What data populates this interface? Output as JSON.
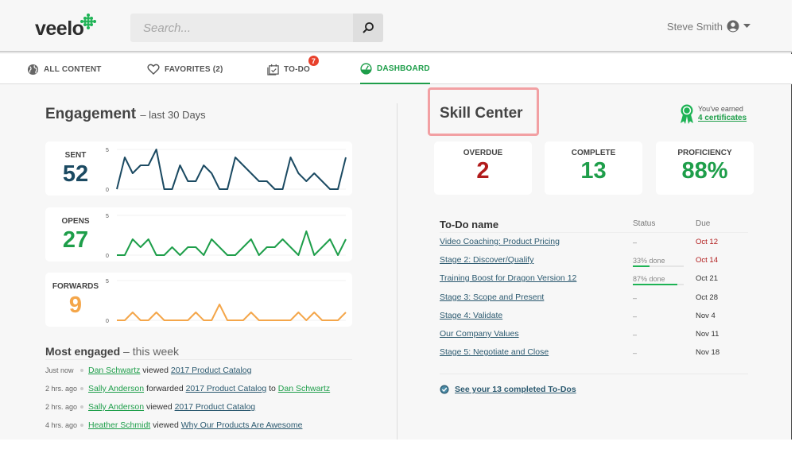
{
  "header": {
    "logo": "veelo",
    "search_placeholder": "Search...",
    "user_name": "Steve Smith"
  },
  "nav": {
    "tabs": [
      {
        "label": "ALL CONTENT",
        "icon": "globe-icon"
      },
      {
        "label": "FAVORITES (2)",
        "icon": "heart-icon"
      },
      {
        "label": "TO-DO",
        "icon": "calendar-check-icon",
        "badge": "7"
      },
      {
        "label": "DASHBOARD",
        "icon": "gauge-icon",
        "active": true
      }
    ]
  },
  "engagement": {
    "title": "Engagement",
    "subtitle": "– last 30 Days",
    "y_max_label": "5",
    "y_min_label": "0",
    "metrics": [
      {
        "label": "SENT",
        "value": "52",
        "color": "#1b4a62",
        "series": [
          0,
          4,
          2,
          3,
          3,
          5,
          0,
          0,
          3,
          1,
          1,
          3,
          2,
          0,
          0,
          4,
          3,
          2,
          1,
          1,
          0,
          0,
          4,
          2,
          1,
          2,
          1,
          0,
          0,
          4
        ]
      },
      {
        "label": "OPENS",
        "value": "27",
        "color": "#1e9e4a",
        "series": [
          0,
          0,
          2,
          1,
          2,
          0,
          0,
          1,
          0,
          1,
          1,
          0,
          2,
          1,
          0,
          0,
          1,
          2,
          0,
          1,
          1,
          2,
          1,
          0,
          3,
          0,
          1,
          2,
          0,
          2
        ]
      },
      {
        "label": "FORWARDS",
        "value": "9",
        "color": "#f4a64a",
        "series": [
          0,
          0,
          1,
          0,
          0,
          1,
          0,
          0,
          0,
          0,
          1,
          0,
          0,
          2,
          0,
          0,
          0,
          1,
          0,
          0,
          0,
          0,
          0,
          1,
          0,
          1,
          0,
          0,
          0,
          1
        ]
      }
    ]
  },
  "most_engaged": {
    "title": "Most engaged",
    "subtitle": "– this week",
    "activities": [
      {
        "time": "Just now",
        "person": "Dan Schwartz",
        "action": "viewed",
        "item": "2017 Product Catalog"
      },
      {
        "time": "2 hrs. ago",
        "person": "Sally Anderson",
        "action": "forwarded",
        "item": "2017 Product Catalog",
        "to_word": "to",
        "target": "Dan Schwartz"
      },
      {
        "time": "2 hrs. ago",
        "person": "Sally Anderson",
        "action": "viewed",
        "item": "2017 Product Catalog"
      },
      {
        "time": "4 hrs. ago",
        "person": "Heather Schmidt",
        "action": "viewed",
        "item": "Why Our Products Are Awesome"
      }
    ]
  },
  "skill_center": {
    "title": "Skill Center",
    "cert_prefix": "You've earned",
    "cert_link": "4 certificates",
    "stats": [
      {
        "label": "OVERDUE",
        "value": "2",
        "color": "#b11b1b"
      },
      {
        "label": "COMPLETE",
        "value": "13",
        "color": "#1e9e4a"
      },
      {
        "label": "PROFICIENCY",
        "value": "88%",
        "color": "#1e9e4a"
      }
    ],
    "table": {
      "headers": {
        "name": "To-Do name",
        "status": "Status",
        "due": "Due"
      },
      "rows": [
        {
          "name": "Video Coaching: Product Pricing",
          "status": "–",
          "due": "Oct 12",
          "overdue": true
        },
        {
          "name": "Stage 2: Discover/Qualify",
          "status": "33% done",
          "progress": 0.33,
          "due": "Oct 14",
          "overdue": true
        },
        {
          "name": "Training Boost for Dragon Version 12",
          "status": "87% done",
          "progress": 0.87,
          "due": "Oct 21"
        },
        {
          "name": "Stage 3: Scope and Present",
          "status": "–",
          "due": "Oct 28"
        },
        {
          "name": "Stage 4: Validate",
          "status": "–",
          "due": "Nov 4"
        },
        {
          "name": "Our Company Values",
          "status": "–",
          "due": "Nov 11"
        },
        {
          "name": "Stage 5: Negotiate and Close",
          "status": "–",
          "due": "Nov 18"
        }
      ]
    },
    "completed_link": "See your 13 completed To-Dos"
  }
}
